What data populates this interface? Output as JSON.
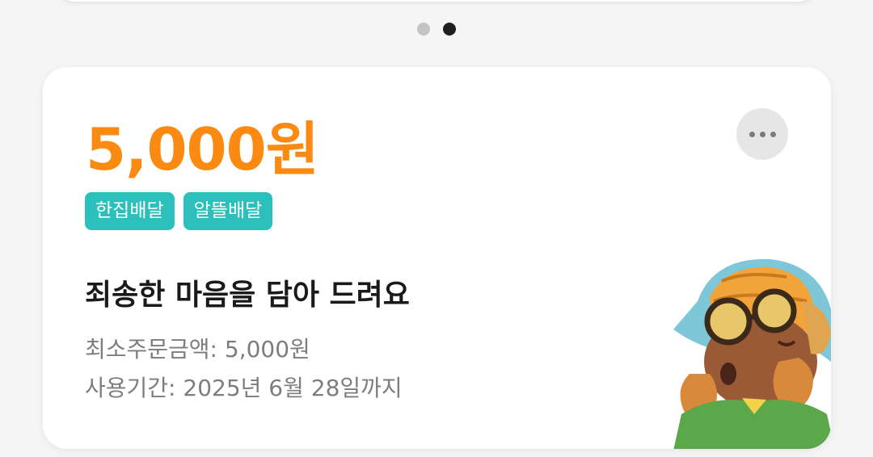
{
  "carousel": {
    "page_count": 2,
    "active_index": 1
  },
  "coupon": {
    "amount": "5,000원",
    "tags": [
      {
        "label": "한집배달"
      },
      {
        "label": "알뜰배달"
      }
    ],
    "headline": "죄송한 마음을 담아 드려요",
    "min_order": "최소주문금액: 5,000원",
    "period": "사용기간: 2025년 6월 28일까지",
    "more_icon": "more-horizontal-icon",
    "mascot_icon": "mascot-character-icon"
  },
  "colors": {
    "amount": "#fb8a12",
    "tag_bg": "#2cc0bc",
    "tag_text": "#ffffff",
    "more_button_bg": "#e6e6e6",
    "dot_inactive": "#c4c4c4",
    "dot_active": "#1f1f1f"
  }
}
